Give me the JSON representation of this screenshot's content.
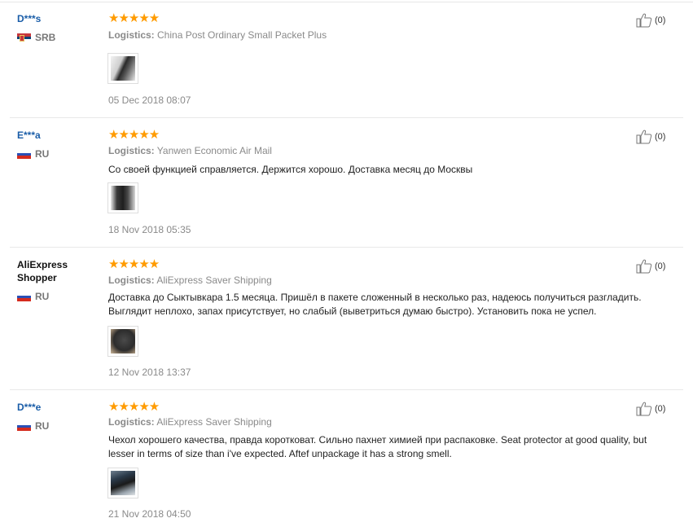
{
  "reviews": [
    {
      "user": "D***s",
      "user_color": "#1a5da8",
      "country": "SRB",
      "flag": "serbia",
      "stars": "★★★★★",
      "rating": 5,
      "logistics_label": "Logistics:",
      "logistics": "China Post Ordinary Small Packet Plus",
      "text": "",
      "date": "05 Dec 2018 08:07",
      "helpful": "(0)",
      "thumb_icon": "photo-thumbnail"
    },
    {
      "user": "E***a",
      "user_color": "#1a5da8",
      "country": "RU",
      "flag": "russia",
      "stars": "★★★★★",
      "rating": 5,
      "logistics_label": "Logistics:",
      "logistics": "Yanwen Economic Air Mail",
      "text": "Со своей функцией справляется. Держится хорошо. Доставка месяц до Москвы",
      "date": "18 Nov 2018 05:35",
      "helpful": "(0)",
      "thumb_icon": "photo-thumbnail"
    },
    {
      "user": "AliExpress Shopper",
      "user_color": "#111111",
      "country": "RU",
      "flag": "russia",
      "stars": "★★★★★",
      "rating": 5,
      "logistics_label": "Logistics:",
      "logistics": "AliExpress Saver Shipping",
      "text_line1": "Доставка до Сыктывкара 1.5 месяца. Пришёл в пакете сложенный в несколько раз, надеюсь получиться разгладить.",
      "text_line2": "Выглядит неплохо, запах присутствует, но слабый (выветриться думаю быстро). Установить пока не успел.",
      "date": "12 Nov 2018 13:37",
      "helpful": "(0)",
      "thumb_icon": "photo-thumbnail"
    },
    {
      "user": "D***e",
      "user_color": "#1a5da8",
      "country": "RU",
      "flag": "russia",
      "stars": "★★★★★",
      "rating": 5,
      "logistics_label": "Logistics:",
      "logistics": "AliExpress Saver Shipping",
      "text_line1": "Чехол хорошего качества, правда коротковат. Сильно пахнет химией при распаковке. Seat protector at good quality, but",
      "text_line2": "lesser in terms of size than i've expected. Aftef unpackage it has a strong smell.",
      "date": "21 Nov 2018 04:50",
      "helpful": "(0)",
      "thumb_icon": "photo-thumbnail"
    }
  ],
  "colors": {
    "star": "#ff9b00",
    "username_link": "#1a5da8",
    "muted_text": "#8a8a8a"
  }
}
